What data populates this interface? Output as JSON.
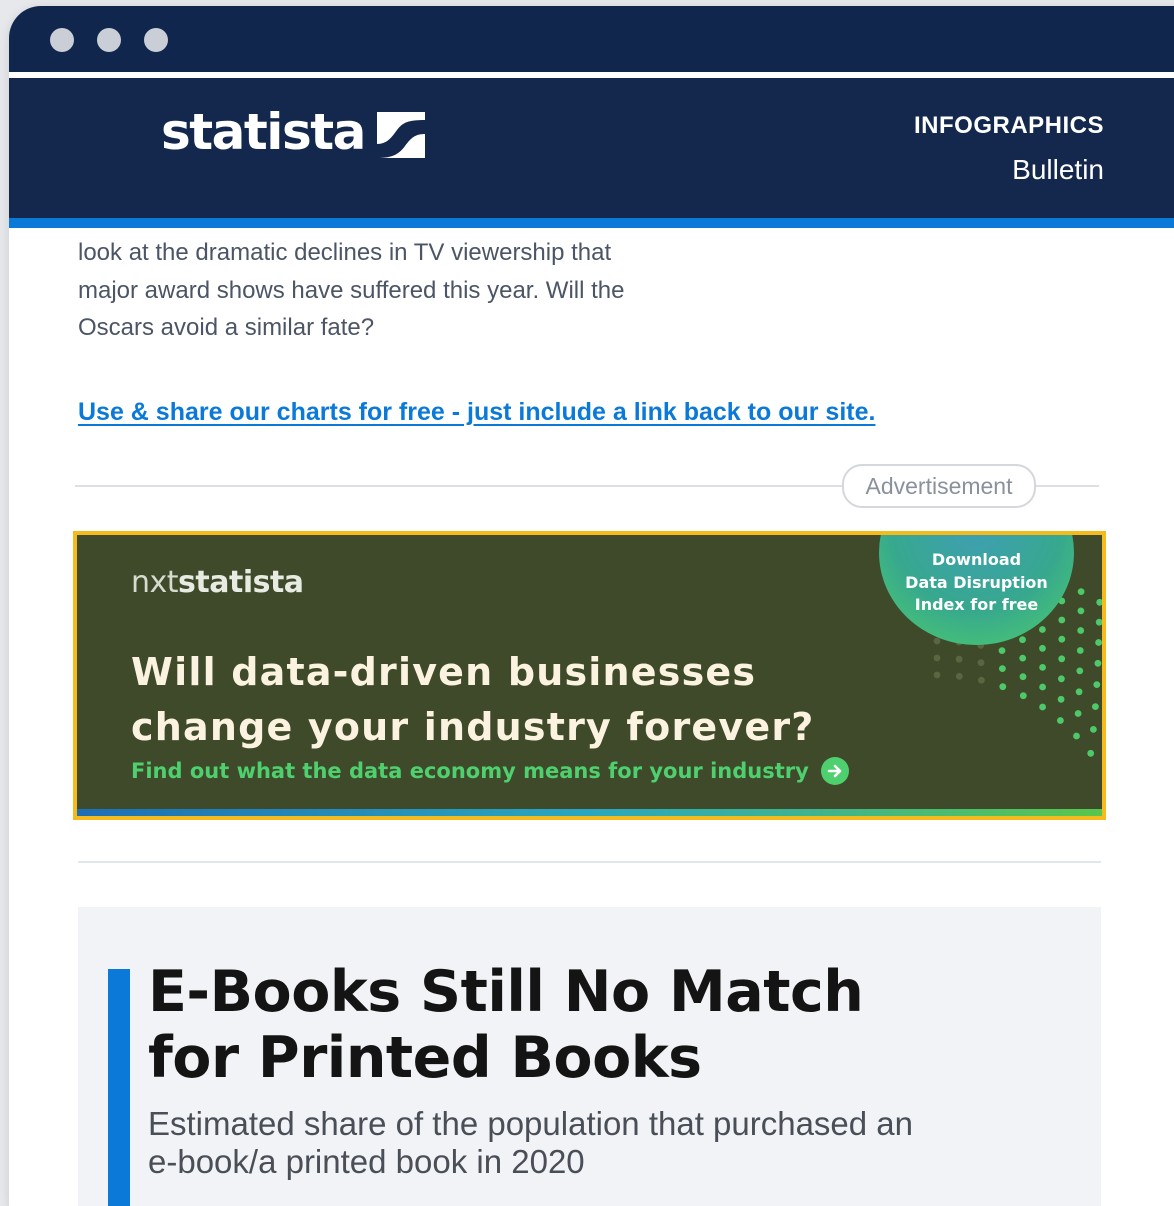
{
  "window": {
    "controls": [
      "window-dot",
      "window-dot",
      "window-dot"
    ]
  },
  "header": {
    "logo_text": "statista",
    "section_label": "INFOGRAPHICS",
    "section_sub": "Bulletin"
  },
  "article": {
    "intro_lines": [
      "look at the dramatic declines in TV viewership that",
      "major award shows have suffered this year. Will the",
      "Oscars avoid a similar fate?"
    ],
    "share_link": "Use & share our charts for free - just include a link back to our site."
  },
  "ad": {
    "label": "Advertisement",
    "brand_light": "nxt",
    "brand_bold": "statista",
    "headline_line1": "Will data-driven businesses",
    "headline_line2": "change your industry forever?",
    "subline": "Find out what the data economy means for your industry",
    "badge_line1": "Download",
    "badge_line2": "Data Disruption",
    "badge_line3": "Index for free",
    "colors": {
      "border": "#f5bb1d",
      "background": "#3e4a2a",
      "accent_green": "#4fd06e"
    }
  },
  "chart_card": {
    "title_line1": "E-Books Still No Match",
    "title_line2": "for Printed Books",
    "subtitle_line1": "Estimated share of the population that purchased an",
    "subtitle_line2": "e-book/a printed book in 2020"
  },
  "colors": {
    "header_bg": "#13284c",
    "accent_blue": "#0b79d8",
    "link": "#0b79d8"
  }
}
